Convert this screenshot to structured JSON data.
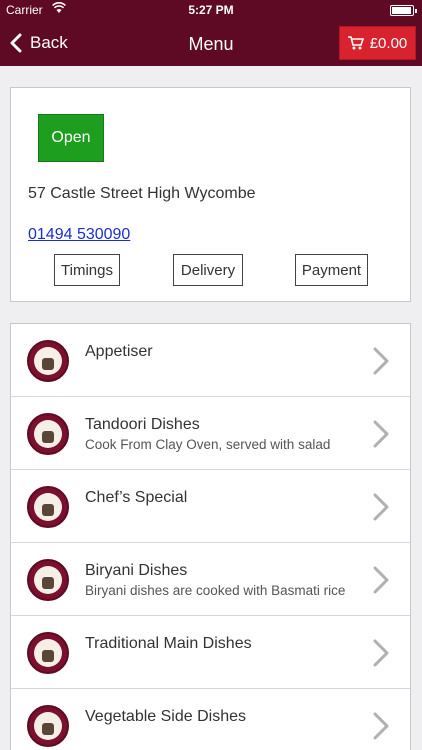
{
  "status_bar": {
    "carrier": "Carrier",
    "time": "5:27 PM"
  },
  "nav": {
    "back_label": "Back",
    "title": "Menu",
    "cart_label": "£0.00"
  },
  "info": {
    "status": "Open",
    "address": "57 Castle Street High Wycombe",
    "phone": "01494 530090",
    "buttons": {
      "timings": "Timings",
      "delivery": "Delivery",
      "payment": "Payment"
    }
  },
  "menu": {
    "items": [
      {
        "title": "Appetiser",
        "description": ""
      },
      {
        "title": "Tandoori Dishes",
        "description": "Cook From Clay Oven, served with salad"
      },
      {
        "title": "Chef’s Special",
        "description": ""
      },
      {
        "title": "Biryani Dishes",
        "description": "Biryani dishes are cooked with Basmati rice"
      },
      {
        "title": "Traditional Main Dishes",
        "description": ""
      },
      {
        "title": "Vegetable Side Dishes",
        "description": ""
      }
    ]
  },
  "colors": {
    "header": "#5e0a24",
    "cart": "#d8232f",
    "open": "#1e9e1e",
    "link": "#1a2fd1"
  },
  "icons": {
    "back": "chevron-left-icon",
    "cart": "cart-icon",
    "item": "chevron-right-icon"
  }
}
